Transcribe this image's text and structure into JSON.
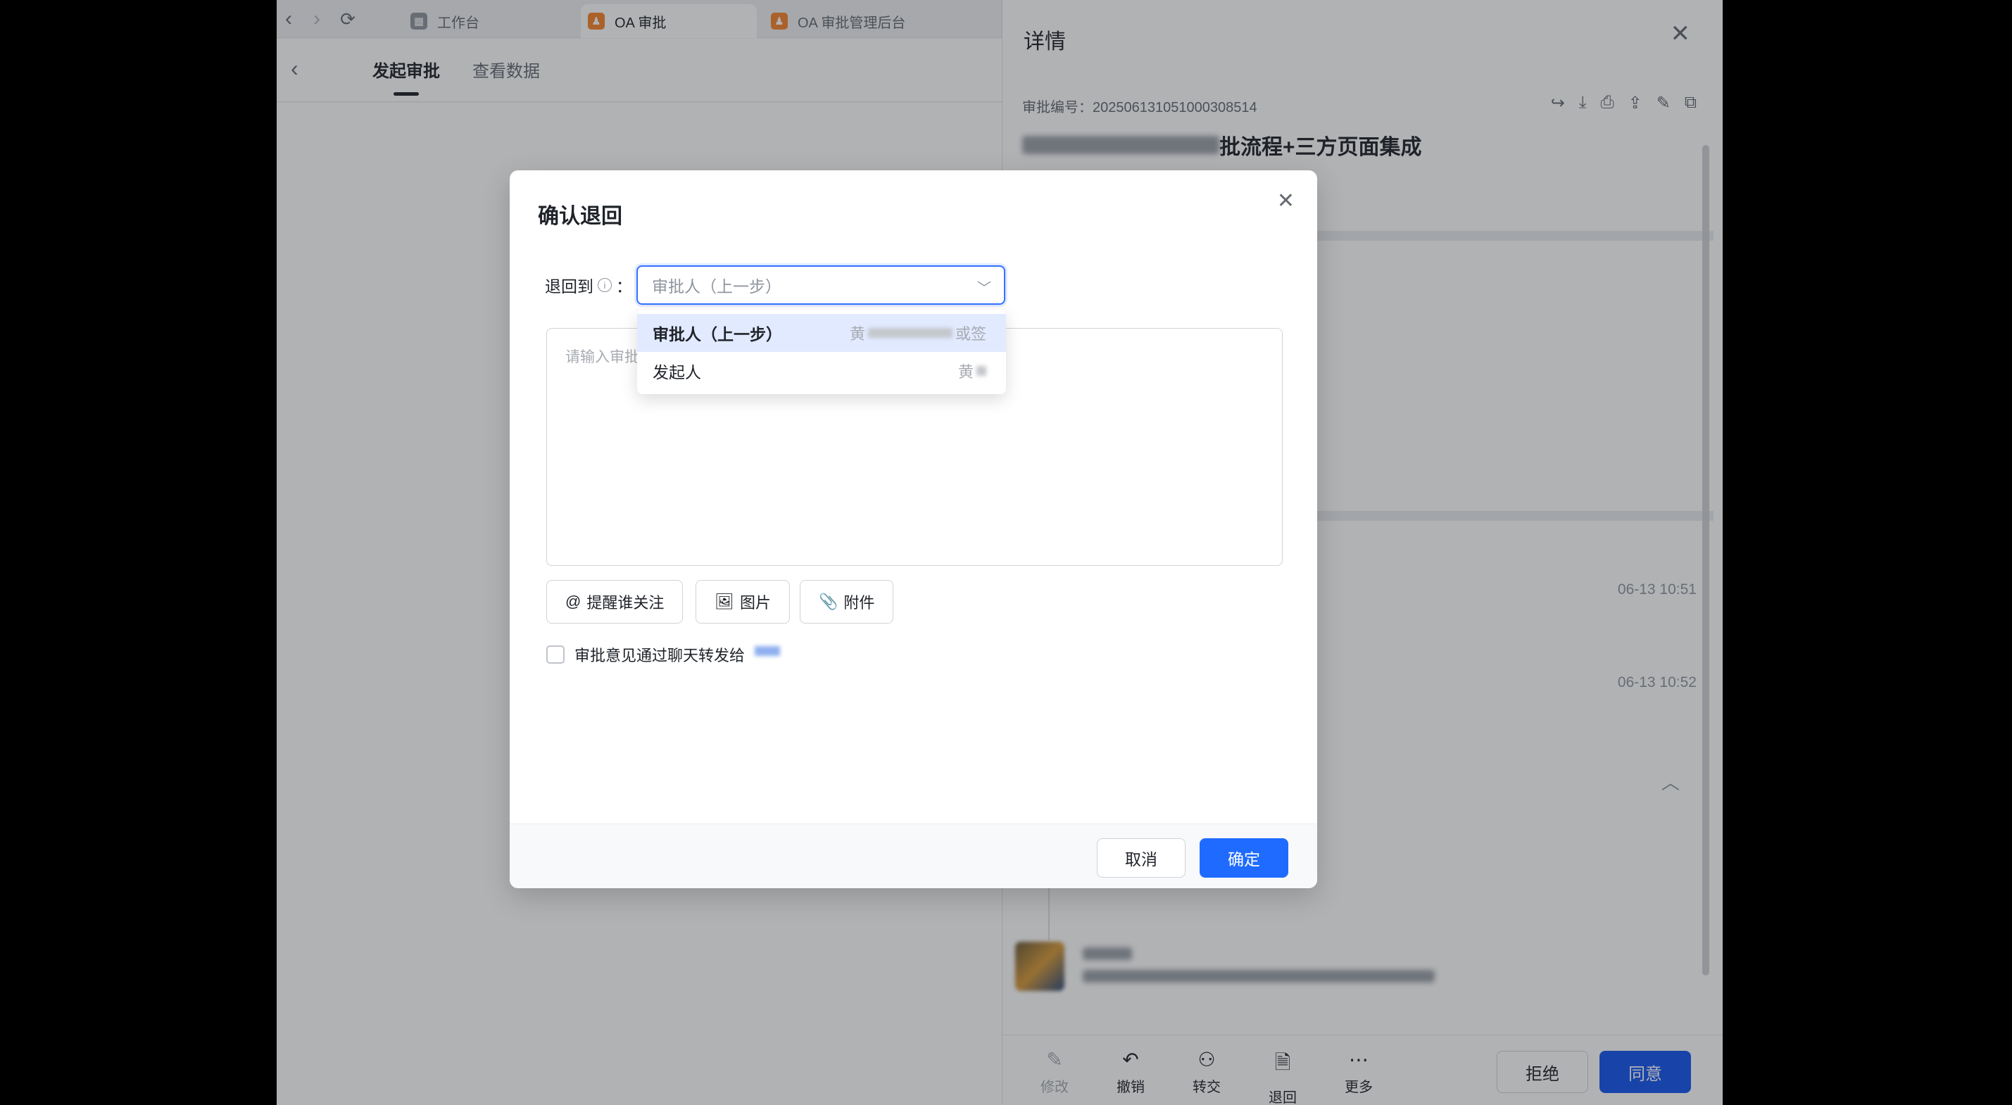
{
  "browser": {
    "tabs": [
      {
        "label": "工作台",
        "icon": "workbench-icon"
      },
      {
        "label": "OA 审批",
        "icon": "oa-approval-icon"
      },
      {
        "label": "OA 审批管理后台",
        "icon": "oa-admin-icon"
      }
    ]
  },
  "page": {
    "tabs": [
      "发起审批",
      "查看数据"
    ]
  },
  "detail": {
    "title": "详情",
    "serial_label": "审批编号：",
    "serial_value": "2025061310510003085​14",
    "title_suffix": "批流程+三方页面集成",
    "times": [
      "06-13 10:51",
      "06-13 10:52"
    ],
    "footer": {
      "modify": "修改",
      "revoke": "撤销",
      "transfer": "转交",
      "return": "退回",
      "more": "更多",
      "reject": "拒绝",
      "agree": "同意"
    }
  },
  "modal": {
    "title": "确认退回",
    "return_to_label": "退回到",
    "colon": "：",
    "select_value": "审批人（上一步）",
    "comment_placeholder": "请输入审批",
    "mention_label": "提醒谁关注",
    "image_label": "图片",
    "attachment_label": "附件",
    "forward_checkbox_label": "审批意见通过聊天转发给",
    "cancel_label": "取消",
    "confirm_label": "确定"
  },
  "dropdown": {
    "options": [
      {
        "label": "审批人（上一步）",
        "sub_prefix": "黄",
        "sub_suffix": "或签"
      },
      {
        "label": "发起人",
        "sub_prefix": "黄",
        "sub_suffix": ""
      }
    ]
  },
  "colors": {
    "primary": "#1f6bff",
    "agree_button": "#1456f0",
    "selected_option_bg": "#e1eaff"
  }
}
